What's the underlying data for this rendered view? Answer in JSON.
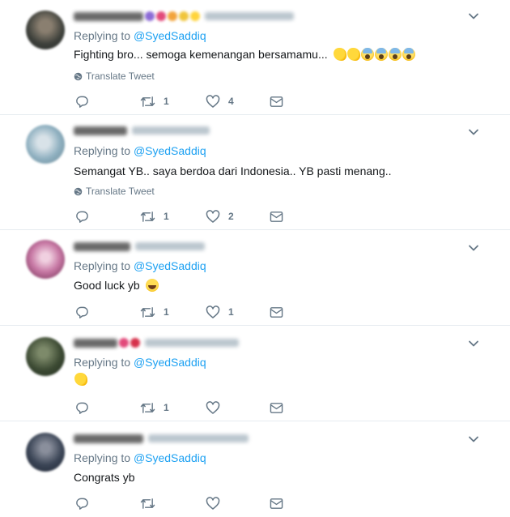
{
  "tweets": [
    {
      "replying_label": "Replying to",
      "mention": "@SyedSaddiq",
      "text": "Fighting bro... semoga kemenangan bersamamu...",
      "emojis": [
        "muscle",
        "muscle",
        "scream",
        "scream",
        "scream",
        "scream"
      ],
      "translate_label": "Translate Tweet",
      "retweets": "1",
      "likes": "4",
      "avatar_color": "#4a4f4a"
    },
    {
      "replying_label": "Replying to",
      "mention": "@SyedSaddiq",
      "text": "Semangat YB.. saya berdoa dari Indonesia.. YB pasti menang..",
      "emojis": [],
      "translate_label": "Translate Tweet",
      "retweets": "1",
      "likes": "2",
      "avatar_color": "#9fb7c4"
    },
    {
      "replying_label": "Replying to",
      "mention": "@SyedSaddiq",
      "text": "Good luck yb",
      "emojis": [
        "grin"
      ],
      "translate_label": "",
      "retweets": "1",
      "likes": "1",
      "avatar_color": "#c07a9a"
    },
    {
      "replying_label": "Replying to",
      "mention": "@SyedSaddiq",
      "text": "",
      "emojis": [
        "muscle"
      ],
      "translate_label": "",
      "retweets": "1",
      "likes": "",
      "avatar_color": "#3e4a36"
    },
    {
      "replying_label": "Replying to",
      "mention": "@SyedSaddiq",
      "text": "Congrats yb",
      "emojis": [],
      "translate_label": "",
      "retweets": "",
      "likes": "",
      "avatar_color": "#2f3a4d"
    }
  ],
  "icons": {
    "reply": "reply-icon",
    "retweet": "retweet-icon",
    "like": "heart-icon",
    "dm": "envelope-icon",
    "caret": "chevron-down-icon",
    "globe": "globe-icon"
  },
  "colors": {
    "link": "#1da1f2",
    "secondary_text": "#657786",
    "divider": "#e6ecf0"
  }
}
